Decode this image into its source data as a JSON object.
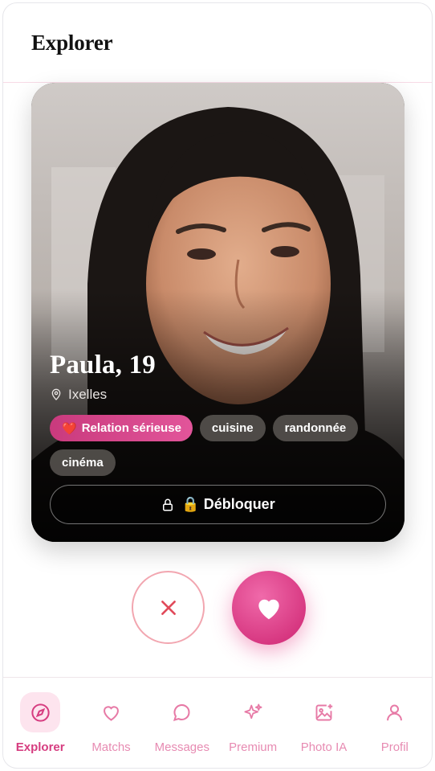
{
  "header": {
    "title": "Explorer"
  },
  "profile": {
    "name_age": "Paula, 19",
    "location": "Ixelles",
    "tags": [
      {
        "label": "Relation sérieuse",
        "icon": "heart-emoji",
        "primary": true
      },
      {
        "label": "cuisine"
      },
      {
        "label": "randonnée"
      },
      {
        "label": "cinéma"
      }
    ],
    "unlock_label": "🔒 Débloquer"
  },
  "actions": {
    "pass": "close-icon",
    "like": "heart-icon"
  },
  "tabs": [
    {
      "label": "Explorer",
      "icon": "compass-icon",
      "active": true
    },
    {
      "label": "Matchs",
      "icon": "heart-outline-icon"
    },
    {
      "label": "Messages",
      "icon": "chat-bubble-icon"
    },
    {
      "label": "Premium",
      "icon": "sparkles-icon"
    },
    {
      "label": "Photo IA",
      "icon": "image-add-icon"
    },
    {
      "label": "Profil",
      "icon": "user-icon"
    }
  ],
  "colors": {
    "accent": "#d63d80",
    "accent_light": "#fde4ee",
    "pass_border": "#f2a6b0"
  }
}
